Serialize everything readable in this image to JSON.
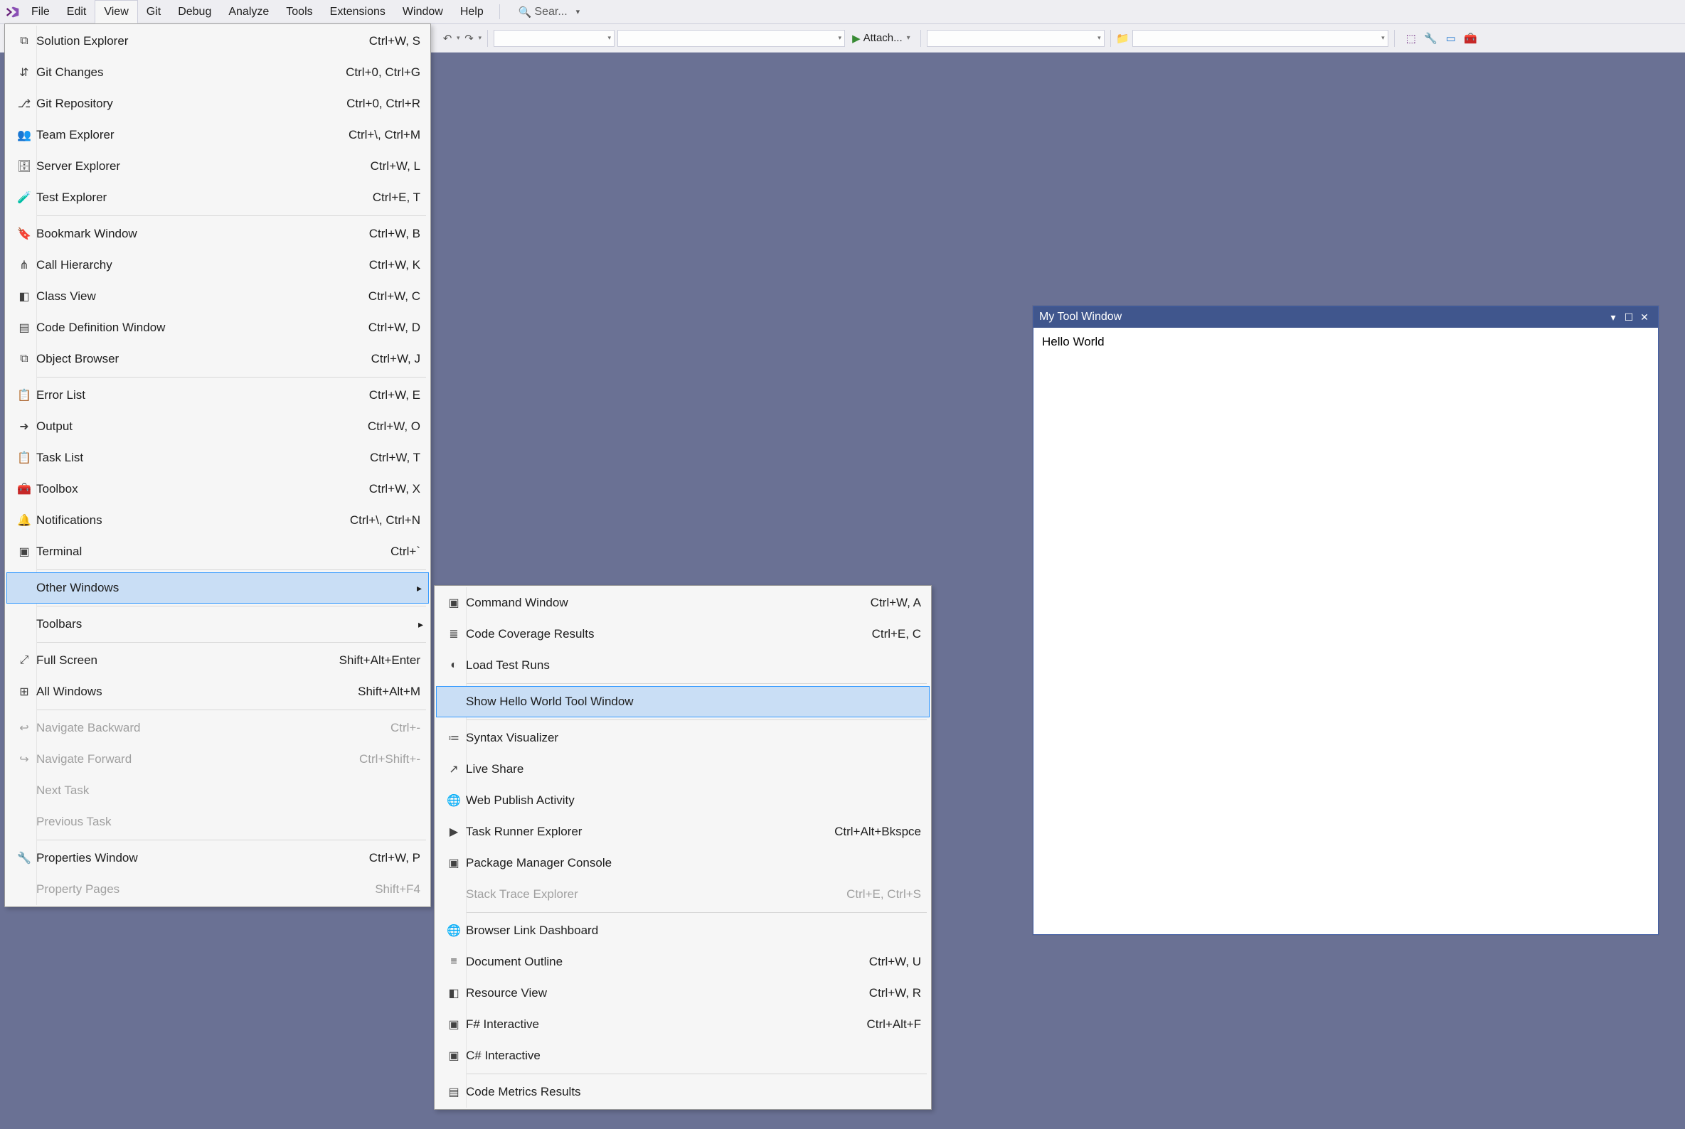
{
  "menubar": {
    "items": [
      "File",
      "Edit",
      "View",
      "Git",
      "Debug",
      "Analyze",
      "Tools",
      "Extensions",
      "Window",
      "Help"
    ],
    "active_index": 2,
    "search_placeholder": "Sear..."
  },
  "toolbar": {
    "attach_label": "Attach..."
  },
  "view_menu": {
    "groups": [
      [
        {
          "icon": "⧉",
          "label": "Solution Explorer",
          "shortcut": "Ctrl+W, S",
          "disabled": false
        },
        {
          "icon": "⇵",
          "label": "Git Changes",
          "shortcut": "Ctrl+0, Ctrl+G",
          "disabled": false
        },
        {
          "icon": "⎇",
          "label": "Git Repository",
          "shortcut": "Ctrl+0, Ctrl+R",
          "disabled": false
        },
        {
          "icon": "👥",
          "label": "Team Explorer",
          "shortcut": "Ctrl+\\, Ctrl+M",
          "disabled": false
        },
        {
          "icon": "🗄",
          "label": "Server Explorer",
          "shortcut": "Ctrl+W, L",
          "disabled": false
        },
        {
          "icon": "🧪",
          "label": "Test Explorer",
          "shortcut": "Ctrl+E, T",
          "disabled": false
        }
      ],
      [
        {
          "icon": "🔖",
          "label": "Bookmark Window",
          "shortcut": "Ctrl+W, B",
          "disabled": false
        },
        {
          "icon": "⋔",
          "label": "Call Hierarchy",
          "shortcut": "Ctrl+W, K",
          "disabled": false
        },
        {
          "icon": "◧",
          "label": "Class View",
          "shortcut": "Ctrl+W, C",
          "disabled": false
        },
        {
          "icon": "▤",
          "label": "Code Definition Window",
          "shortcut": "Ctrl+W, D",
          "disabled": false
        },
        {
          "icon": "⧉",
          "label": "Object Browser",
          "shortcut": "Ctrl+W, J",
          "disabled": false
        }
      ],
      [
        {
          "icon": "📋",
          "label": "Error List",
          "shortcut": "Ctrl+W, E",
          "disabled": false
        },
        {
          "icon": "➜",
          "label": "Output",
          "shortcut": "Ctrl+W, O",
          "disabled": false
        },
        {
          "icon": "📋",
          "label": "Task List",
          "shortcut": "Ctrl+W, T",
          "disabled": false
        },
        {
          "icon": "🧰",
          "label": "Toolbox",
          "shortcut": "Ctrl+W, X",
          "disabled": false
        },
        {
          "icon": "🔔",
          "label": "Notifications",
          "shortcut": "Ctrl+\\, Ctrl+N",
          "disabled": false
        },
        {
          "icon": "▣",
          "label": "Terminal",
          "shortcut": "Ctrl+`",
          "disabled": false
        }
      ],
      [
        {
          "icon": "",
          "label": "Other Windows",
          "shortcut": "",
          "disabled": false,
          "arrow": true,
          "highlight": true
        }
      ],
      [
        {
          "icon": "",
          "label": "Toolbars",
          "shortcut": "",
          "disabled": false,
          "arrow": true
        }
      ],
      [
        {
          "icon": "⤢",
          "label": "Full Screen",
          "shortcut": "Shift+Alt+Enter",
          "disabled": false
        },
        {
          "icon": "⊞",
          "label": "All Windows",
          "shortcut": "Shift+Alt+M",
          "disabled": false
        }
      ],
      [
        {
          "icon": "↩",
          "label": "Navigate Backward",
          "shortcut": "Ctrl+-",
          "disabled": true
        },
        {
          "icon": "↪",
          "label": "Navigate Forward",
          "shortcut": "Ctrl+Shift+-",
          "disabled": true
        },
        {
          "icon": "",
          "label": "Next Task",
          "shortcut": "",
          "disabled": true
        },
        {
          "icon": "",
          "label": "Previous Task",
          "shortcut": "",
          "disabled": true
        }
      ],
      [
        {
          "icon": "🔧",
          "label": "Properties Window",
          "shortcut": "Ctrl+W, P",
          "disabled": false
        },
        {
          "icon": "",
          "label": "Property Pages",
          "shortcut": "Shift+F4",
          "disabled": true
        }
      ]
    ]
  },
  "submenu": {
    "groups": [
      [
        {
          "icon": "▣",
          "label": "Command Window",
          "shortcut": "Ctrl+W, A",
          "disabled": false
        },
        {
          "icon": "≣",
          "label": "Code Coverage Results",
          "shortcut": "Ctrl+E, C",
          "disabled": false
        },
        {
          "icon": "◐",
          "label": "Load Test Runs",
          "shortcut": "",
          "disabled": false
        }
      ],
      [
        {
          "icon": "",
          "label": "Show Hello World Tool Window",
          "shortcut": "",
          "disabled": false,
          "highlight": true
        }
      ],
      [
        {
          "icon": "≔",
          "label": "Syntax Visualizer",
          "shortcut": "",
          "disabled": false
        },
        {
          "icon": "↗",
          "label": "Live Share",
          "shortcut": "",
          "disabled": false
        },
        {
          "icon": "🌐",
          "label": "Web Publish Activity",
          "shortcut": "",
          "disabled": false
        },
        {
          "icon": "▶",
          "label": "Task Runner Explorer",
          "shortcut": "Ctrl+Alt+Bkspce",
          "disabled": false
        },
        {
          "icon": "▣",
          "label": "Package Manager Console",
          "shortcut": "",
          "disabled": false
        },
        {
          "icon": "",
          "label": "Stack Trace Explorer",
          "shortcut": "Ctrl+E, Ctrl+S",
          "disabled": true
        }
      ],
      [
        {
          "icon": "🌐",
          "label": "Browser Link Dashboard",
          "shortcut": "",
          "disabled": false
        },
        {
          "icon": "≡",
          "label": "Document Outline",
          "shortcut": "Ctrl+W, U",
          "disabled": false
        },
        {
          "icon": "◧",
          "label": "Resource View",
          "shortcut": "Ctrl+W, R",
          "disabled": false
        },
        {
          "icon": "▣",
          "label": "F# Interactive",
          "shortcut": "Ctrl+Alt+F",
          "disabled": false
        },
        {
          "icon": "▣",
          "label": "C# Interactive",
          "shortcut": "",
          "disabled": false
        }
      ],
      [
        {
          "icon": "▤",
          "label": "Code Metrics Results",
          "shortcut": "",
          "disabled": false
        }
      ]
    ]
  },
  "tool_window": {
    "title": "My Tool Window",
    "content": "Hello World"
  }
}
